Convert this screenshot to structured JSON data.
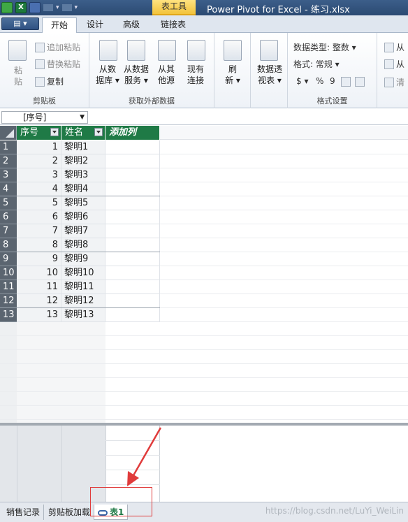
{
  "titlebar": {
    "context_tab": "表工具",
    "title": "Power Pivot for Excel - 练习.xlsx"
  },
  "ribbon_tabs": {
    "file_label": "▤ ▾",
    "tabs": [
      "开始",
      "设计",
      "高级",
      "链接表"
    ],
    "active": "开始"
  },
  "clipboard": {
    "paste_label_1": "粘",
    "paste_label_2": "贴",
    "append_paste": "追加粘贴",
    "replace_paste": "替换粘贴",
    "copy": "复制",
    "group_label": "剪贴板"
  },
  "external": {
    "from_db_1": "从数",
    "from_db_2": "据库 ▾",
    "from_service_1": "从数据",
    "from_service_2": "服务 ▾",
    "from_other_1": "从其",
    "from_other_2": "他源",
    "existing_1": "现有",
    "existing_2": "连接",
    "group_label": "获取外部数据"
  },
  "refresh": {
    "label_1": "刷",
    "label_2": "新 ▾"
  },
  "pivot": {
    "label_1": "数据透",
    "label_2": "视表 ▾"
  },
  "format": {
    "data_type": "数据类型: 整数 ▾",
    "format": "格式: 常规 ▾",
    "currency": "$ ▾",
    "percent": "%",
    "comma": "9",
    "group_label": "格式设置"
  },
  "sort": {
    "asc_label": "从",
    "desc_label": "从",
    "clear_label": "清"
  },
  "formula_bar": {
    "name_box": "[序号]"
  },
  "table": {
    "headers": [
      "序号",
      "姓名",
      "添加列"
    ],
    "row_numbers": [
      "1",
      "2",
      "3",
      "4",
      "5",
      "6",
      "7",
      "8",
      "9",
      "10",
      "11",
      "12",
      "13"
    ],
    "rows": [
      {
        "id": "1",
        "name": "黎明1"
      },
      {
        "id": "2",
        "name": "黎明2"
      },
      {
        "id": "3",
        "name": "黎明3"
      },
      {
        "id": "4",
        "name": "黎明4"
      },
      {
        "id": "5",
        "name": "黎明5"
      },
      {
        "id": "6",
        "name": "黎明6"
      },
      {
        "id": "7",
        "name": "黎明7"
      },
      {
        "id": "8",
        "name": "黎明8"
      },
      {
        "id": "9",
        "name": "黎明9"
      },
      {
        "id": "10",
        "name": "黎明10"
      },
      {
        "id": "11",
        "name": "黎明11"
      },
      {
        "id": "12",
        "name": "黎明12"
      },
      {
        "id": "13",
        "name": "黎明13"
      }
    ]
  },
  "sheet_tabs": {
    "tabs": [
      "销售记录",
      "剪贴板加载",
      "表1"
    ],
    "active": "表1",
    "watermark": "https://blog.csdn.net/LuYi_WeiLin"
  },
  "colors": {
    "header_green": "#1f7a46",
    "annotation_red": "#e03b3b",
    "title_blue": "#2b4a72"
  }
}
